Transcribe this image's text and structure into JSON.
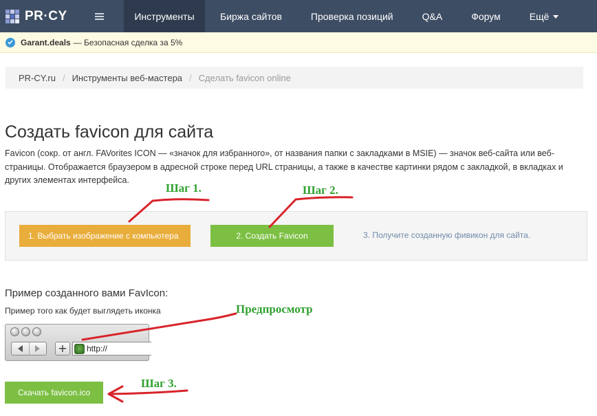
{
  "navbar": {
    "logo_text": "PR·CY",
    "items": [
      {
        "label": "Инструменты",
        "active": true
      },
      {
        "label": "Биржа сайтов"
      },
      {
        "label": "Проверка позиций"
      },
      {
        "label": "Q&A"
      },
      {
        "label": "Форум"
      },
      {
        "label": "Ещё"
      }
    ],
    "background": "#3d4d63",
    "active_background": "#2e3b4e"
  },
  "promo": {
    "brand": "Garant.deals",
    "text": "— Безопасная сделка за 5%"
  },
  "breadcrumb": {
    "items": [
      "PR-CY.ru",
      "Инструменты веб-мастера",
      "Сделать favicon online"
    ],
    "separator": "/"
  },
  "page": {
    "title": "Создать favicon для сайта",
    "description": "Favicon (сокр. от англ. FAVorites ICON — «значок для избранного», от названия папки с закладками в MSIE) — значок веб-сайта или веб-страницы. Отображается браузером в адресной строке перед URL страницы, а также в качестве картинки рядом с закладкой, в вкладках и других элементах интерфейса."
  },
  "steps": {
    "step1_label": "1. Выбрать изображение с компьютера",
    "step2_label": "2. Создать Favicon",
    "step3_label": "3. Получите созданную фивикон для сайта.",
    "step1_color": "#e8ad3b",
    "step2_color": "#7cbf43"
  },
  "example": {
    "title": "Пример созданного вами FavIcon:",
    "subtitle": "Пример того как будет выглядеть иконка",
    "url_text": "http://",
    "plus": "+"
  },
  "download": {
    "label": "Скачать favicon.ico"
  },
  "annotations": {
    "step1": "Шаг 1.",
    "step2": "Шаг 2.",
    "preview": "Предпросмотр",
    "step3": "Шаг 3.",
    "text_color": "#2fa12f",
    "arrow_color": "#d8232a"
  }
}
